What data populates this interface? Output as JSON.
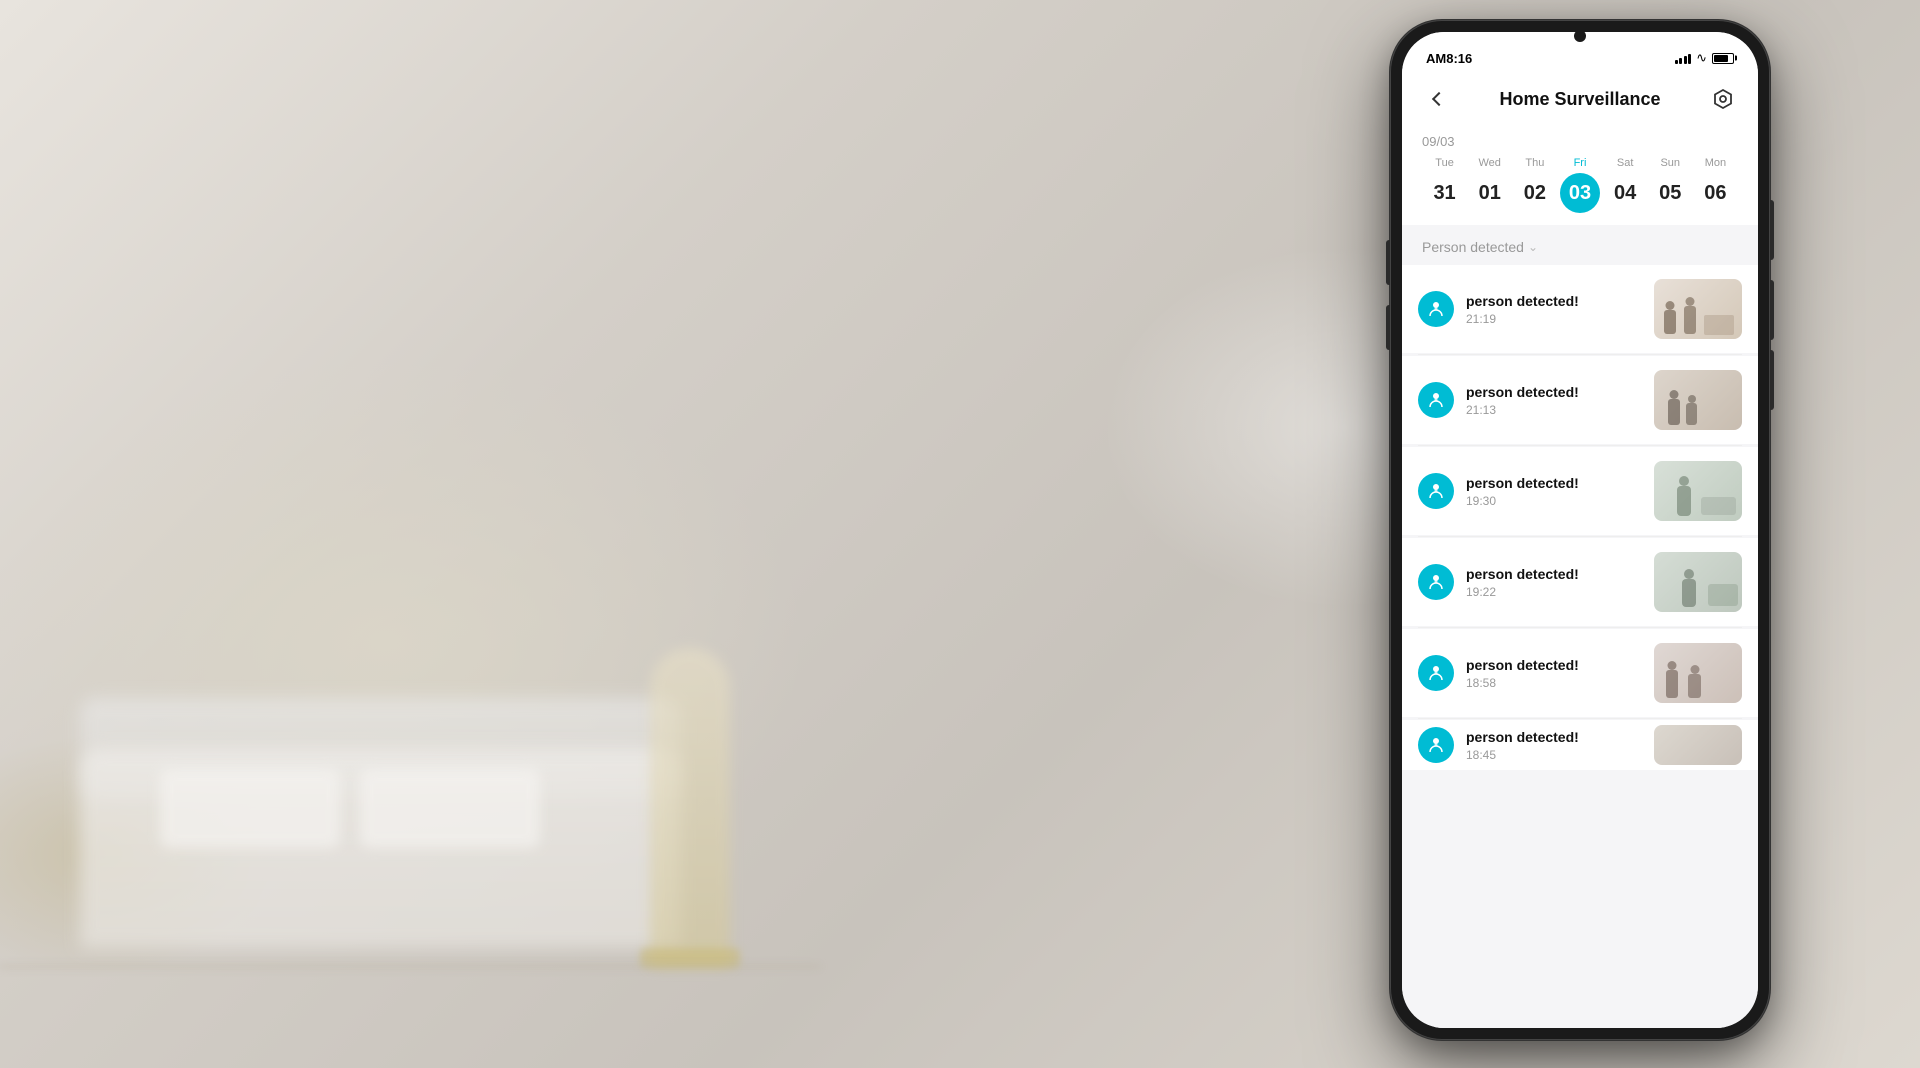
{
  "background": {
    "description": "Blurred living room interior"
  },
  "phone": {
    "status_bar": {
      "time": "AM8:16",
      "signal_label": "signal",
      "wifi_label": "wifi",
      "battery_label": "battery"
    },
    "header": {
      "back_label": "back",
      "title": "Home  Surveillance",
      "settings_label": "settings"
    },
    "date_section": {
      "date_label": "09/03",
      "days": [
        {
          "name": "Tue",
          "num": "31",
          "active": false
        },
        {
          "name": "Wed",
          "num": "01",
          "active": false
        },
        {
          "name": "Thu",
          "num": "02",
          "active": false
        },
        {
          "name": "Fri",
          "num": "03",
          "active": true
        },
        {
          "name": "Sat",
          "num": "04",
          "active": false
        },
        {
          "name": "Sun",
          "num": "05",
          "active": false
        },
        {
          "name": "Mon",
          "num": "06",
          "active": false
        }
      ]
    },
    "filter": {
      "label": "Person detected",
      "chevron": "⌄"
    },
    "events": [
      {
        "id": 1,
        "title": "person detected!",
        "time": "21:19",
        "thumb_class": "thumb-1"
      },
      {
        "id": 2,
        "title": "person detected!",
        "time": "21:13",
        "thumb_class": "thumb-2"
      },
      {
        "id": 3,
        "title": "person detected!",
        "time": "19:30",
        "thumb_class": "thumb-3"
      },
      {
        "id": 4,
        "title": "person detected!",
        "time": "19:22",
        "thumb_class": "thumb-4"
      },
      {
        "id": 5,
        "title": "person detected!",
        "time": "18:58",
        "thumb_class": "thumb-5"
      },
      {
        "id": 6,
        "title": "person detected!",
        "time": "18:45",
        "thumb_class": "thumb-6"
      }
    ]
  }
}
